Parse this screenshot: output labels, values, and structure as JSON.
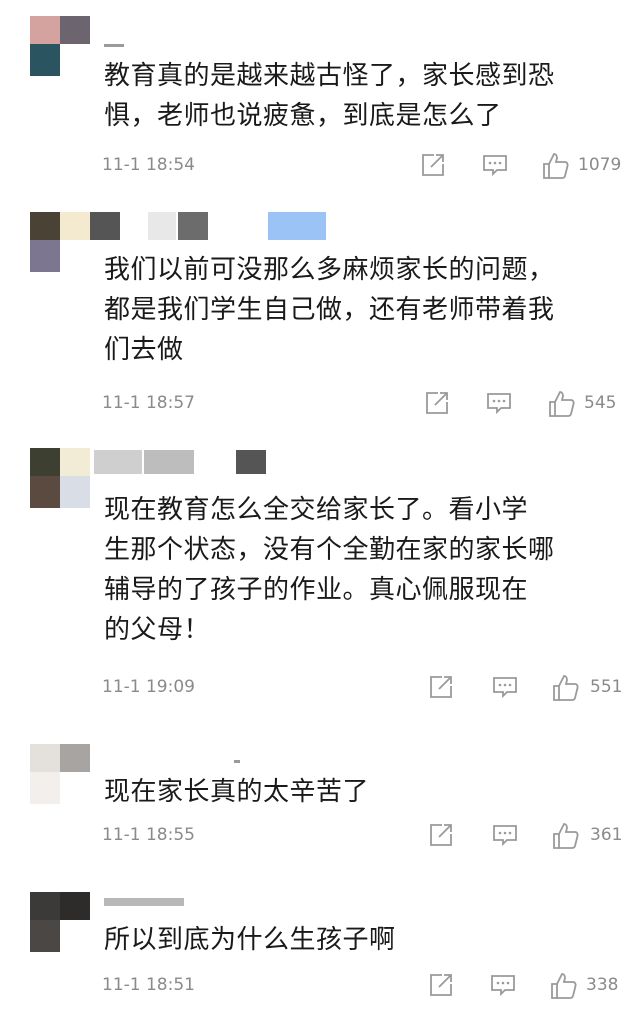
{
  "comments": [
    {
      "text": "教育真的是越来越古怪了，家长感到恐\n惧，老师也说疲惫，到底是怎么了",
      "time": "11-1 18:54",
      "likes": "1079"
    },
    {
      "text": "我们以前可没那么多麻烦家长的问题，\n都是我们学生自己做，还有老师带着我\n们去做",
      "time": "11-1 18:57",
      "likes": "545"
    },
    {
      "text": "现在教育怎么全交给家长了。看小学\n生那个状态，没有个全勤在家的家长哪\n辅导的了孩子的作业。真心佩服现在\n的父母！",
      "time": "11-1 19:09",
      "likes": "551"
    },
    {
      "text": "现在家长真的太辛苦了",
      "time": "11-1 18:55",
      "likes": "361"
    },
    {
      "text": "所以到底为什么生孩子啊",
      "time": "11-1 18:51",
      "likes": "338"
    }
  ],
  "icons": {
    "share": "share-icon",
    "reply": "comment-icon",
    "like": "thumbs-up-icon"
  },
  "colors": {
    "text": "#1a1a1a",
    "meta": "#8a8a8a",
    "icon": "#9a9a9a"
  }
}
